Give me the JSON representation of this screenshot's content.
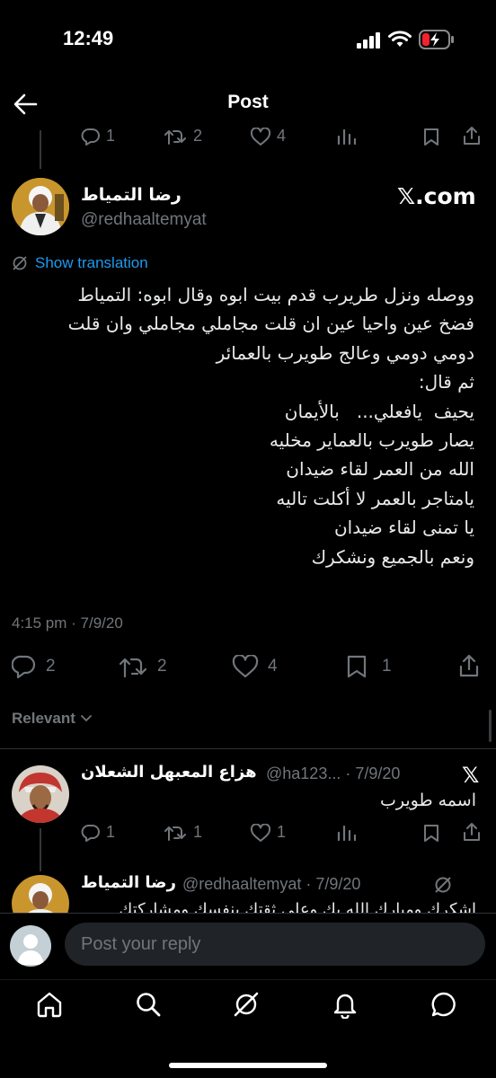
{
  "status_bar": {
    "time": "12:49"
  },
  "header": {
    "title": "Post"
  },
  "parent_actions": {
    "replies": "1",
    "reposts": "2",
    "likes": "4"
  },
  "main_post": {
    "author_name": "رضا التمياط",
    "handle": "@redhaaltemyat",
    "source_badge": "𝕏.com",
    "show_translation": "Show translation",
    "body": "ووصله ونزل طريرب قدم بيت ابوه وقال ابوه: التمياط\nفضخ عين واحيا عين ان قلت مجاملي مجاملي وان قلت\nدومي دومي وعالج طويرب بالعمائر\nثم قال:\nيحيف  يافعلي...   بالأيمان\nيصار طويرب بالعماير مخليه\nالله من العمر لقاء ضيدان\nيامتاجر بالعمر لا أكلت تاليه\nيا تمنى لقاء ضيدان\nونعم بالجميع ونشكرك",
    "timestamp": "4:15 pm · 7/9/20",
    "replies": "2",
    "reposts": "2",
    "likes": "4",
    "bookmarks": "1"
  },
  "sort": {
    "label": "Relevant"
  },
  "replies": [
    {
      "author_name": "هزاع المعبهل الشعلان",
      "handle_date": "@ha123... · 7/9/20",
      "text": "اسمه طويرب",
      "replies": "1",
      "reposts": "1",
      "likes": "1"
    },
    {
      "author_name": "رضا التمياط",
      "handle_date": "@redhaaltemyat · 7/9/20",
      "text": "اشكرك ومبارك الله بك وعلى ثقتك بنفسك ومشاركتك"
    }
  ],
  "composer": {
    "placeholder": "Post your reply"
  },
  "bottom_nav": [
    "home",
    "search",
    "grok",
    "notifications",
    "messages"
  ],
  "colors": {
    "accent": "#1d9bf0",
    "background": "#000000",
    "muted": "#71767b",
    "text": "#e7e9ea",
    "battery": "#f4212e"
  }
}
